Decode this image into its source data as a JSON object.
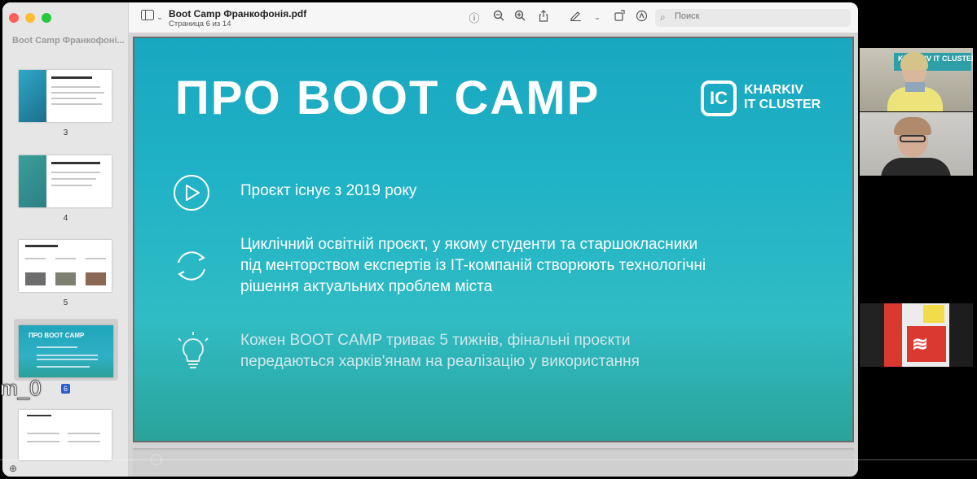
{
  "window": {
    "title": "Boot Camp Франкофонія.pdf",
    "subtitle": "Страница 6 из 14"
  },
  "sidebar": {
    "title": "Boot Camp Франкофоні...",
    "pages": [
      {
        "num": "3",
        "heading": "Про Харківський IT Кластер"
      },
      {
        "num": "4",
        "heading": "Харківський IT Кластер у цифрах"
      },
      {
        "num": "5",
        "heading": "Values for participants & partners"
      },
      {
        "num": "6",
        "heading": "ПРО BOOT CAMP"
      },
      {
        "num": "",
        "heading": "Мета створення проєкту Boot Camp"
      }
    ],
    "overlay_label": "m_0"
  },
  "toolbar": {
    "search_placeholder": "Поиск",
    "icons": [
      "sidebar-toggle-icon",
      "chevron-down-icon",
      "info-icon",
      "zoom-out-icon",
      "zoom-in-icon",
      "share-icon",
      "markup-pen-icon",
      "chevron-down-icon",
      "rotate-icon",
      "annotate-icon",
      "search-icon"
    ]
  },
  "slide": {
    "title": "ПРО BOOT CAMP",
    "logo_mark": "IC",
    "logo_line1": "KHARKIV",
    "logo_line2": "IT CLUSTER",
    "rows": [
      {
        "icon": "play-icon",
        "text": "Проєкт існує з 2019 року"
      },
      {
        "icon": "cycle-icon",
        "text_line1": "Циклічний освітній проєкт, у якому студенти та старшокласники",
        "text_line2": "під менторством експертів із IT-компаній створюють технологічні",
        "text_line3": "рішення актуальних проблем міста"
      },
      {
        "icon": "lightbulb-icon",
        "text_line1": "Кожен BOOT CAMP триває 5 тижнів, фінальні проєкти",
        "text_line2": "передаються харків'янам на реалізацію у використання"
      }
    ]
  },
  "video_tiles": [
    {
      "label": "KHARKIV IT CLUSTER"
    },
    {
      "label": ""
    },
    {
      "label": ""
    }
  ]
}
